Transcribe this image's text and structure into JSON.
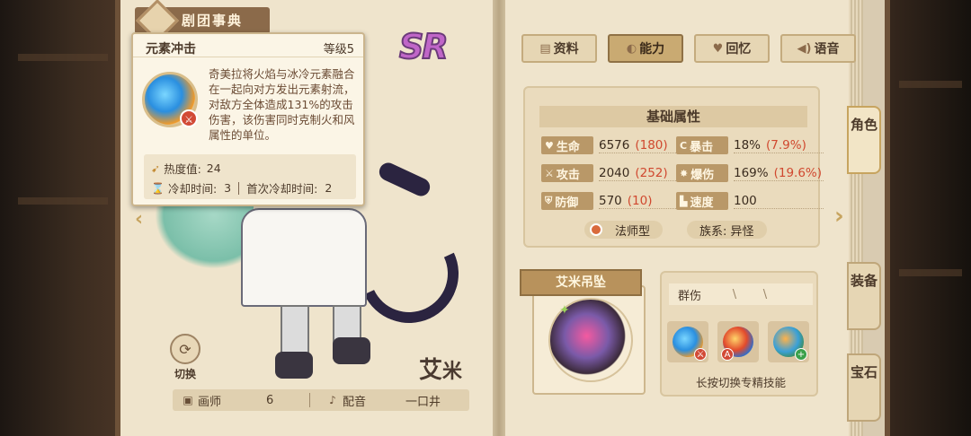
{
  "header": {
    "title": "剧团事典"
  },
  "rarity": "SR",
  "character": {
    "name_first": "艾",
    "name_rest": "米"
  },
  "switch": {
    "label": "切换"
  },
  "credits": {
    "artist_label": "画师",
    "artist": "6",
    "voice_label": "配音",
    "voice": "一口井"
  },
  "tooltip": {
    "title": "元素冲击",
    "level": "等级5",
    "description": "奇美拉将火焰与冰冷元素融合在一起向对方发出元素射流，对敌方全体造成131%的攻击伤害，该伤害同时克制火和风属性的单位。",
    "heat_label": "热度值:",
    "heat_value": "24",
    "cooldown_label": "冷却时间:",
    "cooldown_value": "3",
    "first_cooldown_label": "首次冷却时间:",
    "first_cooldown_value": "2"
  },
  "tabs": [
    {
      "label": "资料",
      "icon": "document-icon"
    },
    {
      "label": "能力",
      "icon": "ability-icon",
      "active": true
    },
    {
      "label": "回忆",
      "icon": "heart-icon"
    },
    {
      "label": "语音",
      "icon": "speaker-icon"
    }
  ],
  "side_tabs": [
    {
      "label": "角色",
      "active": true
    },
    {
      "label": "装备"
    },
    {
      "label": "宝石"
    }
  ],
  "attributes": {
    "title": "基础属性",
    "hp": {
      "label": "生命",
      "value": "6576",
      "bonus": "(180)"
    },
    "crit": {
      "label": "暴击",
      "value": "18%",
      "bonus": "(7.9%)"
    },
    "atk": {
      "label": "攻击",
      "value": "2040",
      "bonus": "(252)"
    },
    "critdmg": {
      "label": "爆伤",
      "value": "169%",
      "bonus": "(19.6%)"
    },
    "def": {
      "label": "防御",
      "value": "570",
      "bonus": "(10)"
    },
    "speed": {
      "label": "速度",
      "value": "100"
    },
    "type": "法师型",
    "race": "族系: 异怪"
  },
  "pendant": {
    "title": "艾米吊坠"
  },
  "skills": {
    "tag_label": "群伤",
    "slash1": "\\",
    "slash2": "\\",
    "hint": "长按切换专精技能"
  },
  "colors": {
    "accent": "#c9aa72",
    "bonus": "#d0482f",
    "rarity": "#c066c8"
  }
}
